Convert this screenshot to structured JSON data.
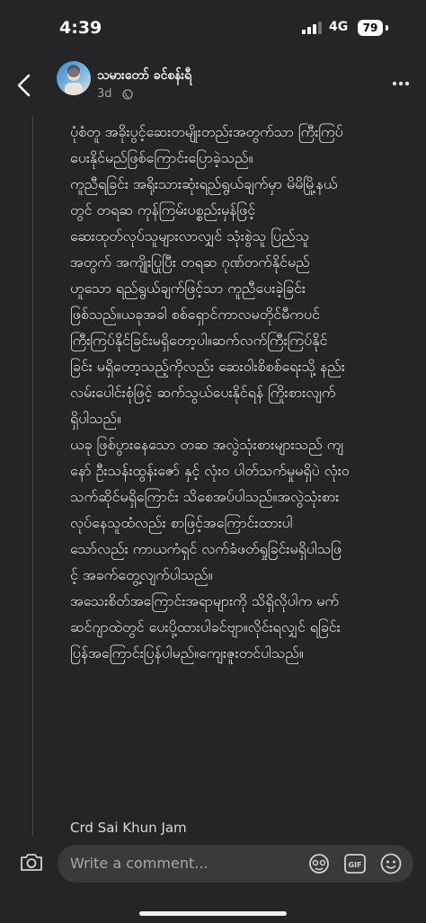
{
  "status": {
    "time": "4:39",
    "network": "4G",
    "battery": "79"
  },
  "post": {
    "author": "သမားတော် ခင်စန်းရီ",
    "age": "3d",
    "paragraphs": [
      [
        "ပုံစံတူ အခိုးပွင့်ဆေးတမျိုးတည်းအတွက်သာ ကြီးကြပ်",
        "ပေးနိုင်မည်ဖြစ်ကြောင်းပြောခဲ့သည်။"
      ],
      [
        "ကူညီရခြင်း အရိုးသားဆုံးရည်ရွယ်ချက်မှာ မိမိမြို့နယ်",
        "တွင် တရဆ ကုန်ကြမ်းပစ္စည်းမှန်ဖြင့်",
        "ဆေးထုတ်လုပ်သူများလာလျှင် သုံးစွဲသူ ပြည်သူ",
        "အတွက် အကျိုးပြုပြီး တရဆ ဂုဏ်တက်နိုင်မည်",
        "ဟူသော ရည်ရွယ်ချက်ဖြင့်သာ ကူညီပေးခဲ့ခြင်း",
        "ဖြစ်သည်။ယခုအခါ စစ်ရှောင်ကာလမတိုင်မီကပင်",
        "ကြီးကြပ်နိုင်ခြင်းမရှိတော့ပါ။ဆက်လက်ကြီးကြပ်နိုင်",
        "ခြင်း မရှိတော့သည့်ကိုလည်း ဆေးဝါးစိစစ်ရေးသို့ နည်း",
        "လမ်းပေါင်းစုံဖြင့် ဆက်သွယ်ပေးနိုင်ရန် ကြိုးစားလျက်",
        "ရှိပါသည်။"
      ],
      [
        "ယခု ဖြစ်ပွားနေသော တဆ အလွဲသုံးစားများသည် ကျ",
        "နော် ဦးသန်းထွန်းဇော် နှင့် လုံးဝ ပါတ်သက်မှုမရှိပဲ လုံးဝ",
        "သက်ဆိုင်မရှိကြောင်း သိစေအပ်ပါသည်။အလွဲသုံးစား",
        "လုပ်နေသူထံလည်း စာဖြင့်အကြောင်းထားပါ",
        "သော်လည်း ကာယကံရှင် လက်ခံဖတ်ရှုခြင်းမရှိပါသဖြ",
        "င့် အခက်တွေ့လျက်ပါသည်။"
      ],
      [
        "အသေးစိတ်အကြောင်းအရာများကို သိရှိလိုပါက မက်",
        "ဆင်ဂျာထဲတွင် ပေးပို့ထားပါခင်ဗျာ။လိုင်းရလျှင် ရခြင်း",
        "ပြန်အကြောင်းပြန်ပါမည်။ကျေးဇူးတင်ပါသည်။"
      ]
    ],
    "credit": "Crd Sai Khun Jam"
  },
  "comment": {
    "placeholder": "Write a comment..."
  }
}
